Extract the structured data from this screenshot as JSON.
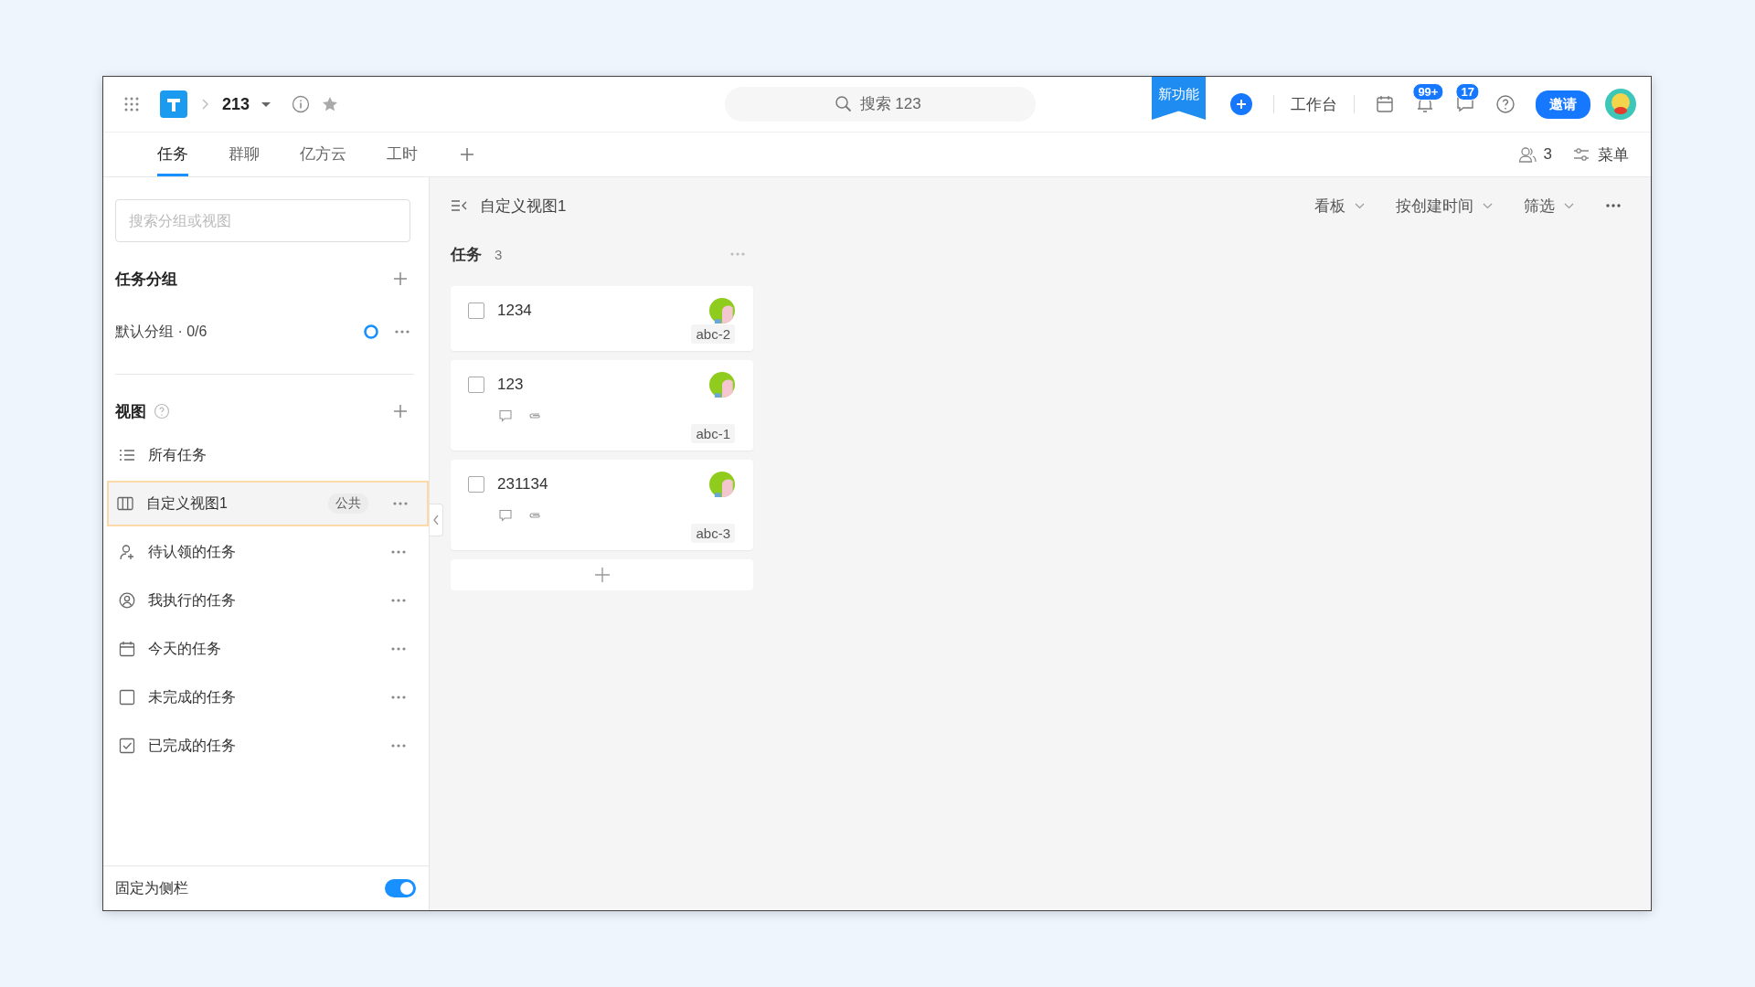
{
  "topbar": {
    "project": "213",
    "search": {
      "placeholder": "搜索 123"
    },
    "new_feature": "新功能",
    "workbench": "工作台",
    "notification_badge": "99+",
    "message_badge": "17",
    "invite": "邀请"
  },
  "tabs": [
    {
      "label": "任务",
      "selected": true
    },
    {
      "label": "群聊",
      "selected": false
    },
    {
      "label": "亿方云",
      "selected": false
    },
    {
      "label": "工时",
      "selected": false
    }
  ],
  "members_count": "3",
  "menu": "菜单",
  "sidebar": {
    "search": {
      "placeholder": "搜索分组或视图"
    },
    "groups_title": "任务分组",
    "groups": [
      {
        "name": "默认分组 · 0/6"
      }
    ],
    "views_title": "视图",
    "views": [
      {
        "kind": "list",
        "label": "所有任务",
        "selected": false
      },
      {
        "kind": "board",
        "label": "自定义视图1",
        "badge": "公共",
        "selected": true
      },
      {
        "kind": "claim",
        "label": "待认领的任务",
        "selected": false
      },
      {
        "kind": "person",
        "label": "我执行的任务",
        "selected": false
      },
      {
        "kind": "calendar",
        "label": "今天的任务",
        "selected": false
      },
      {
        "kind": "open",
        "label": "未完成的任务",
        "selected": false
      },
      {
        "kind": "done",
        "label": "已完成的任务",
        "selected": false
      }
    ],
    "pin_label": "固定为侧栏",
    "pin_on": true
  },
  "board": {
    "view_title": "自定义视图1",
    "controls": [
      "看板",
      "按创建时间",
      "筛选"
    ],
    "column": {
      "title": "任务",
      "count": "3",
      "cards": [
        {
          "title": "1234",
          "checked": false,
          "code": "abc-2",
          "extras": false
        },
        {
          "title": "123",
          "checked": false,
          "code": "abc-1",
          "extras": true
        },
        {
          "title": "231134",
          "checked": false,
          "code": "abc-3",
          "extras": true
        }
      ]
    }
  }
}
